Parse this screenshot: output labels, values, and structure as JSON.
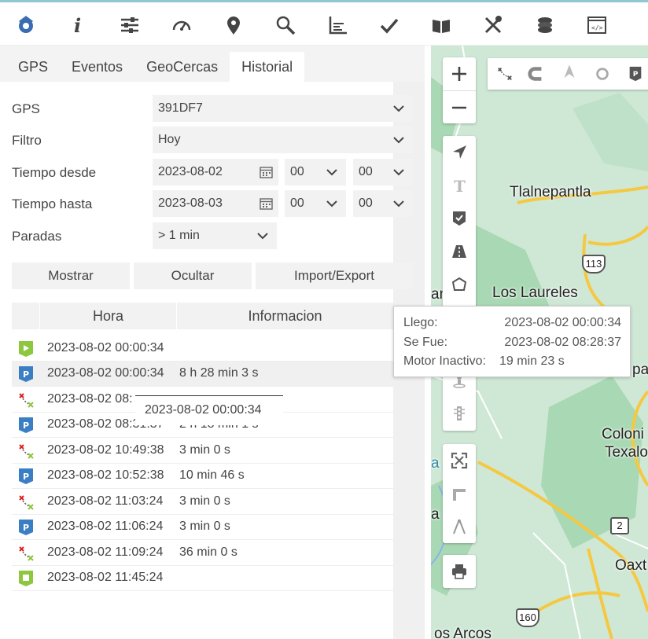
{
  "toolbar": {
    "icons": [
      "satellite-icon",
      "info-icon",
      "sliders-icon",
      "speedometer-icon",
      "location-pin-icon",
      "search-icon",
      "chart-axis-icon",
      "checkmark-icon",
      "book-icon",
      "tools-icon",
      "coins-icon",
      "code-window-icon"
    ]
  },
  "tabs": [
    "GPS",
    "Eventos",
    "GeoCercas",
    "Historial"
  ],
  "active_tab": "Historial",
  "form": {
    "gps_label": "GPS",
    "gps_value": "391DF7",
    "filtro_label": "Filtro",
    "filtro_value": "Hoy",
    "desde_label": "Tiempo desde",
    "desde_date": "2023-08-02",
    "desde_hour": "00",
    "desde_min": "00",
    "hasta_label": "Tiempo hasta",
    "hasta_date": "2023-08-03",
    "hasta_hour": "00",
    "hasta_min": "00",
    "paradas_label": "Paradas",
    "paradas_value": "> 1 min"
  },
  "buttons": {
    "mostrar": "Mostrar",
    "ocultar": "Ocultar",
    "import_export": "Import/Export"
  },
  "table": {
    "col_hora": "Hora",
    "col_info": "Informacion",
    "rows": [
      {
        "type": "start",
        "time": "2023-08-02 00:00:34",
        "info": ""
      },
      {
        "type": "parking",
        "time": "2023-08-02 00:00:34",
        "info": "8 h 28 min 3 s"
      },
      {
        "type": "route",
        "time": "2023-08-02 08:",
        "info": ""
      },
      {
        "type": "parking",
        "time": "2023-08-02 08:31:37",
        "info": "2 h 18 min 1 s"
      },
      {
        "type": "route",
        "time": "2023-08-02 10:49:38",
        "info": "3 min 0 s"
      },
      {
        "type": "parking",
        "time": "2023-08-02 10:52:38",
        "info": "10 min 46 s"
      },
      {
        "type": "route",
        "time": "2023-08-02 11:03:24",
        "info": "3 min 0 s"
      },
      {
        "type": "parking",
        "time": "2023-08-02 11:06:24",
        "info": "3 min 0 s"
      },
      {
        "type": "route",
        "time": "2023-08-02 11:09:24",
        "info": "36 min 0 s"
      },
      {
        "type": "end",
        "time": "2023-08-02 11:45:24",
        "info": ""
      }
    ]
  },
  "tooltip": "2023-08-02 00:00:34",
  "popup": {
    "llego_label": "Llego:",
    "llego_value": "2023-08-02 00:00:34",
    "sefue_label": "Se Fue:",
    "sefue_value": "2023-08-02 08:28:37",
    "motor_label": "Motor Inactivo:",
    "motor_value": "19 min 23 s"
  },
  "map": {
    "places": [
      "Tlalnepantla",
      "Los Laureles",
      "Coloni",
      "Texalo",
      "Oaxt",
      "os Arcos",
      "an",
      "a",
      "a",
      "pa"
    ],
    "shields": [
      "113",
      "2",
      "160"
    ]
  },
  "colors": {
    "accent_green": "#8dc63f",
    "parking_blue": "#3a7fc4",
    "route_red": "#e02020",
    "map_road": "#f5c842",
    "map_green": "#cfe8d6",
    "map_dark_green": "#a9d8b4"
  }
}
